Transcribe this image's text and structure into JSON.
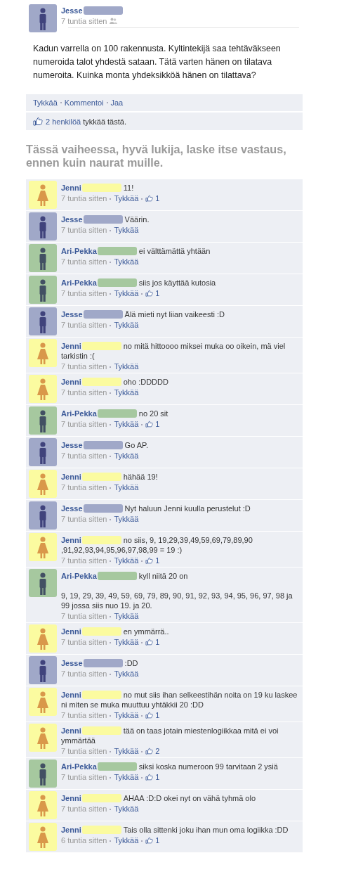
{
  "post": {
    "author": "Jesse",
    "avatar": {
      "kind": "male",
      "color": "#a0a8c8"
    },
    "time": "7 tuntia sitten",
    "text": "Kadun varrella on 100 rakennusta. Kyltintekijä saa tehtäväkseen numeroida talot yhdestä sataan. Tätä varten hänen on tilatava numeroita. Kuinka monta yhdeksikköä hänen on tilattava?",
    "actions": [
      "Tykkää",
      "Kommentoi",
      "Jaa"
    ],
    "likes_link": "2 henkilöä",
    "likes_rest": " tykkää tästä."
  },
  "heading": "Tässä vaiheessa, hyvä lukija, laske itse vastaus, ennen kuin naurat muille.",
  "comments": [
    {
      "author": "Jenni",
      "avatar": {
        "kind": "female",
        "color": "#fbfba0"
      },
      "text": "11!",
      "time": "7 tuntia sitten",
      "like": "Tykkää",
      "likes": "1"
    },
    {
      "author": "Jesse",
      "avatar": {
        "kind": "male",
        "color": "#a0a8c8"
      },
      "text": "Väärin.",
      "time": "7 tuntia sitten",
      "like": "Tykkää"
    },
    {
      "author": "Ari-Pekka",
      "avatar": {
        "kind": "male",
        "color": "#a6c89f"
      },
      "text": "ei välttämättä yhtään",
      "time": "7 tuntia sitten",
      "like": "Tykkää"
    },
    {
      "author": "Ari-Pekka",
      "avatar": {
        "kind": "male",
        "color": "#a6c89f"
      },
      "text": "siis jos käyttää kutosia",
      "time": "7 tuntia sitten",
      "like": "Tykkää",
      "likes": "1"
    },
    {
      "author": "Jesse",
      "avatar": {
        "kind": "male",
        "color": "#a0a8c8"
      },
      "text": "Älä mieti nyt liian vaikeesti :D",
      "time": "7 tuntia sitten",
      "like": "Tykkää"
    },
    {
      "author": "Jenni",
      "avatar": {
        "kind": "female",
        "color": "#fbfba0"
      },
      "text": "no mitä hittoooo miksei muka oo oikein, mä viel tarkistin :(",
      "time": "7 tuntia sitten",
      "like": "Tykkää"
    },
    {
      "author": "Jenni",
      "avatar": {
        "kind": "female",
        "color": "#fbfba0"
      },
      "text": "oho :DDDDD",
      "time": "7 tuntia sitten",
      "like": "Tykkää"
    },
    {
      "author": "Ari-Pekka",
      "avatar": {
        "kind": "male",
        "color": "#a6c89f"
      },
      "text": "no 20 sit",
      "time": "7 tuntia sitten",
      "like": "Tykkää",
      "likes": "1"
    },
    {
      "author": "Jesse",
      "avatar": {
        "kind": "male",
        "color": "#a0a8c8"
      },
      "text": "Go AP.",
      "time": "7 tuntia sitten",
      "like": "Tykkää"
    },
    {
      "author": "Jenni",
      "avatar": {
        "kind": "female",
        "color": "#fbfba0"
      },
      "text": "hähää 19!",
      "time": "7 tuntia sitten",
      "like": "Tykkää"
    },
    {
      "author": "Jesse",
      "avatar": {
        "kind": "male",
        "color": "#a0a8c8"
      },
      "text": "Nyt haluun Jenni kuulla perustelut :D",
      "time": "7 tuntia sitten",
      "like": "Tykkää"
    },
    {
      "author": "Jenni",
      "avatar": {
        "kind": "female",
        "color": "#fbfba0"
      },
      "text": "no siis, 9, 19,29,39,49,59,69,79,89,90 ,91,92,93,94,95,96,97,98,99 = 19 :)",
      "time": "7 tuntia sitten",
      "like": "Tykkää",
      "likes": "1"
    },
    {
      "author": "Ari-Pekka",
      "avatar": {
        "kind": "male",
        "color": "#a6c89f"
      },
      "text": "kyll niitä 20 on\n\n9, 19, 29, 39, 49, 59, 69, 79, 89, 90, 91, 92, 93, 94, 95, 96, 97, 98 ja 99 jossa siis nuo 19. ja 20.",
      "time": "7 tuntia sitten",
      "like": "Tykkää"
    },
    {
      "author": "Jenni",
      "avatar": {
        "kind": "female",
        "color": "#fbfba0"
      },
      "text": "en ymmärrä..",
      "time": "7 tuntia sitten",
      "like": "Tykkää",
      "likes": "1"
    },
    {
      "author": "Jesse",
      "avatar": {
        "kind": "male",
        "color": "#a0a8c8"
      },
      "text": ":DD",
      "time": "7 tuntia sitten",
      "like": "Tykkää"
    },
    {
      "author": "Jenni",
      "avatar": {
        "kind": "female",
        "color": "#fbfba0"
      },
      "text": "no mut siis ihan selkeestihän noita on 19 ku laskee ni miten se muka muuttuu yhtäkkii 20 :DD",
      "time": "7 tuntia sitten",
      "like": "Tykkää",
      "likes": "1"
    },
    {
      "author": "Jenni",
      "avatar": {
        "kind": "female",
        "color": "#fbfba0"
      },
      "text": "tää on taas jotain miestenlogiikkaa mitä ei voi ymmärtää",
      "time": "7 tuntia sitten",
      "like": "Tykkää",
      "likes": "2"
    },
    {
      "author": "Ari-Pekka",
      "avatar": {
        "kind": "male",
        "color": "#a6c89f"
      },
      "text": "siksi koska numeroon 99 tarvitaan 2 ysiä",
      "time": "7 tuntia sitten",
      "like": "Tykkää",
      "likes": "1"
    },
    {
      "author": "Jenni",
      "avatar": {
        "kind": "female",
        "color": "#fbfba0"
      },
      "text": "AHAA :D:D okei nyt on vähä tyhmä olo",
      "time": "7 tuntia sitten",
      "like": "Tykkää"
    },
    {
      "author": "Jenni",
      "avatar": {
        "kind": "female",
        "color": "#fbfba0"
      },
      "text": "Tais olla sittenki joku ihan mun oma logiikka :DD",
      "time": "6 tuntia sitten",
      "like": "Tykkää",
      "likes": "1"
    }
  ]
}
